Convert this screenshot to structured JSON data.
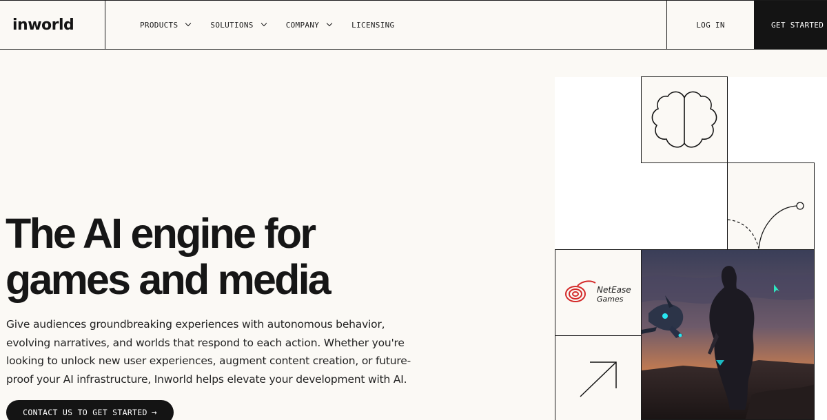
{
  "header": {
    "logo_text": "inworld",
    "nav": [
      {
        "label": "PRODUCTS",
        "has_dropdown": true
      },
      {
        "label": "SOLUTIONS",
        "has_dropdown": true
      },
      {
        "label": "COMPANY",
        "has_dropdown": true
      },
      {
        "label": "LICENSING",
        "has_dropdown": false
      }
    ],
    "login_label": "LOG IN",
    "get_started_label": "GET STARTED"
  },
  "hero": {
    "headline_line1": "The AI engine for",
    "headline_line2": "games and media",
    "subtext": "Give audiences groundbreaking experiences with autonomous behavior, evolving narratives, and worlds that respond to each action. Whether you're looking to unlock new user experiences, augment content creation, or future-proof your AI infrastructure, Inworld helps elevate your development with AI.",
    "cta_label": "CONTACT US TO GET STARTED",
    "cta_arrow": "→"
  },
  "panel": {
    "partner_logo_line1": "NetEase",
    "partner_logo_line2": "Games",
    "icons": [
      "brain-icon",
      "curve-arc-icon",
      "netease-logo",
      "arrow-up-right-icon"
    ]
  },
  "colors": {
    "background": "#fbf9f5",
    "ink": "#141414",
    "netease_red": "#d42a2a"
  }
}
